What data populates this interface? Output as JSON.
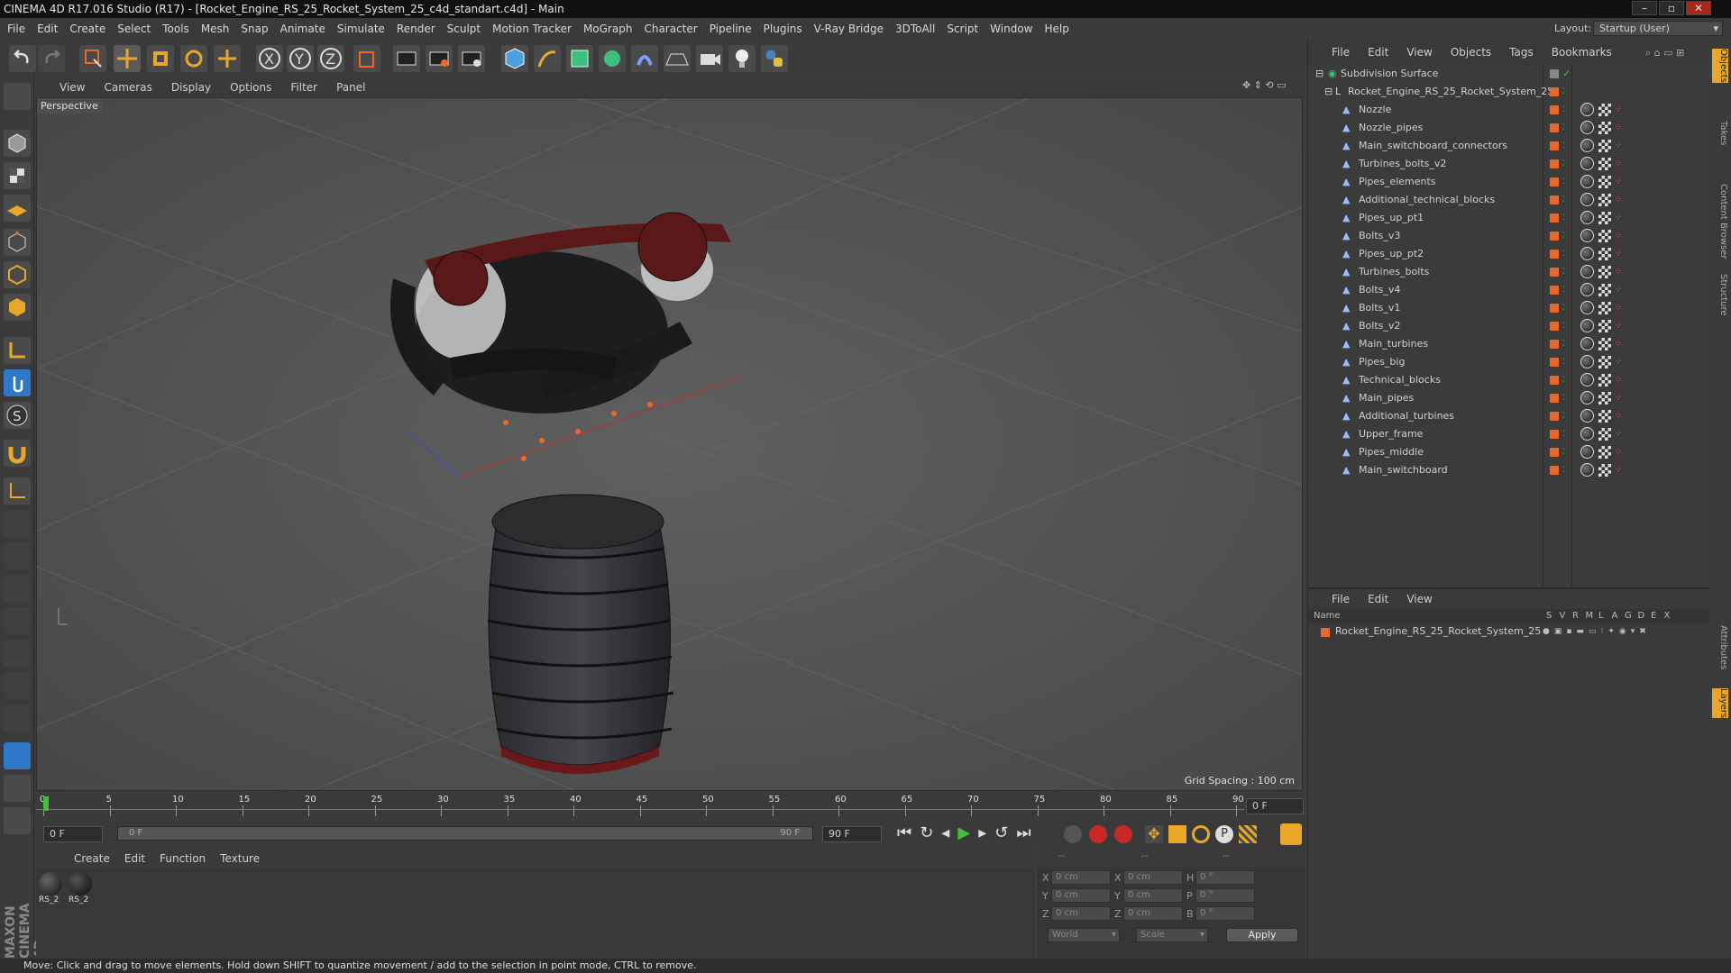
{
  "title": "CINEMA 4D R17.016 Studio (R17) - [Rocket_Engine_RS_25_Rocket_System_25_c4d_standart.c4d] - Main",
  "menu": [
    "File",
    "Edit",
    "Create",
    "Select",
    "Tools",
    "Mesh",
    "Snap",
    "Animate",
    "Simulate",
    "Render",
    "Sculpt",
    "Motion Tracker",
    "MoGraph",
    "Character",
    "Pipeline",
    "Plugins",
    "V-Ray Bridge",
    "3DToAll",
    "Script",
    "Window",
    "Help"
  ],
  "layout": {
    "label": "Layout:",
    "value": "Startup (User)"
  },
  "viewport": {
    "menu": [
      "View",
      "Cameras",
      "Display",
      "Options",
      "Filter",
      "Panel"
    ],
    "camera": "Perspective",
    "grid_spacing": "Grid Spacing : 100 cm"
  },
  "timeline": {
    "ticks": [
      "0",
      "5",
      "10",
      "15",
      "20",
      "25",
      "30",
      "35",
      "40",
      "45",
      "50",
      "55",
      "60",
      "65",
      "70",
      "75",
      "80",
      "85",
      "90"
    ],
    "frame_right": "0 F"
  },
  "playback": {
    "current": "0 F",
    "range_start": "0 F",
    "range_end": "90 F",
    "end": "90 F"
  },
  "materials": {
    "menu": [
      "Create",
      "Edit",
      "Function",
      "Texture"
    ],
    "items": [
      "RS_2",
      "RS_2"
    ]
  },
  "coords": {
    "headers": [
      "--",
      "--",
      "--"
    ],
    "rows": [
      [
        "X",
        "0 cm",
        "X",
        "0 cm",
        "H",
        "0 °"
      ],
      [
        "Y",
        "0 cm",
        "Y",
        "0 cm",
        "P",
        "0 °"
      ],
      [
        "Z",
        "0 cm",
        "Z",
        "0 cm",
        "B",
        "0 °"
      ]
    ],
    "world": "World",
    "scale": "Scale",
    "apply": "Apply"
  },
  "objects": {
    "menu": [
      "File",
      "Edit",
      "View",
      "Objects",
      "Tags",
      "Bookmarks"
    ],
    "root": "Subdivision Surface",
    "group": "Rocket_Engine_RS_25_Rocket_System_25",
    "children": [
      "Nozzle",
      "Nozzle_pipes",
      "Main_switchboard_connectors",
      "Turbines_bolts_v2",
      "Pipes_elements",
      "Additional_technical_blocks",
      "Pipes_up_pt1",
      "Bolts_v3",
      "Pipes_up_pt2",
      "Turbines_bolts",
      "Bolts_v4",
      "Bolts_v1",
      "Bolts_v2",
      "Main_turbines",
      "Pipes_big",
      "Technical_blocks",
      "Main_pipes",
      "Additional_turbines",
      "Upper_frame",
      "Pipes_middle",
      "Main_switchboard"
    ]
  },
  "layers": {
    "menu": [
      "File",
      "Edit",
      "View"
    ],
    "name_header": "Name",
    "flags": [
      "S",
      "V",
      "R",
      "M",
      "L",
      "A",
      "G",
      "D",
      "E",
      "X"
    ],
    "item": "Rocket_Engine_RS_25_Rocket_System_25"
  },
  "sidetabs": [
    "Objects",
    "Takes",
    "Content Browser",
    "Structure",
    "Attributes",
    "Layers"
  ],
  "status": "Move: Click and drag to move elements. Hold down SHIFT to quantize movement / add to the selection in point mode, CTRL to remove.",
  "colors": {
    "accent": "#e8692a",
    "bg": "#3a3a3a",
    "viewport": "#595959"
  }
}
